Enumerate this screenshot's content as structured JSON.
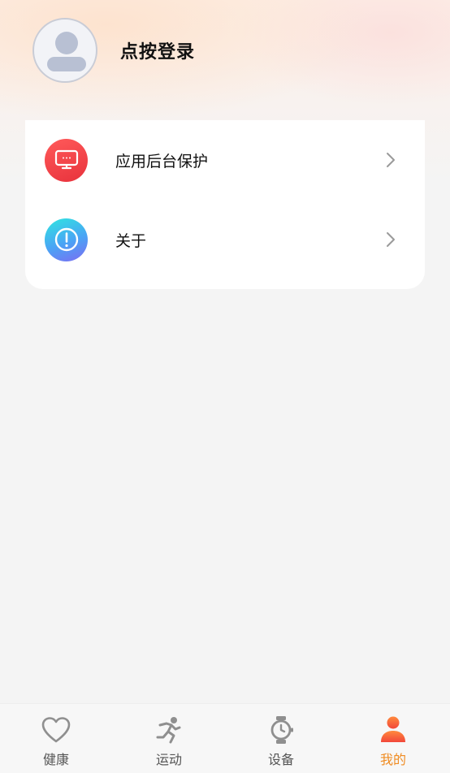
{
  "profile": {
    "login_label": "点按登录"
  },
  "menu": {
    "items": [
      {
        "label": "应用后台保护",
        "icon": "monitor-icon"
      },
      {
        "label": "关于",
        "icon": "info-icon"
      }
    ]
  },
  "tabbar": {
    "tabs": [
      {
        "label": "健康",
        "icon": "heart-icon",
        "active": false
      },
      {
        "label": "运动",
        "icon": "running-icon",
        "active": false
      },
      {
        "label": "设备",
        "icon": "watch-icon",
        "active": false
      },
      {
        "label": "我的",
        "icon": "person-icon",
        "active": true
      }
    ],
    "active_color": "#f08c22",
    "inactive_color": "#555555"
  }
}
